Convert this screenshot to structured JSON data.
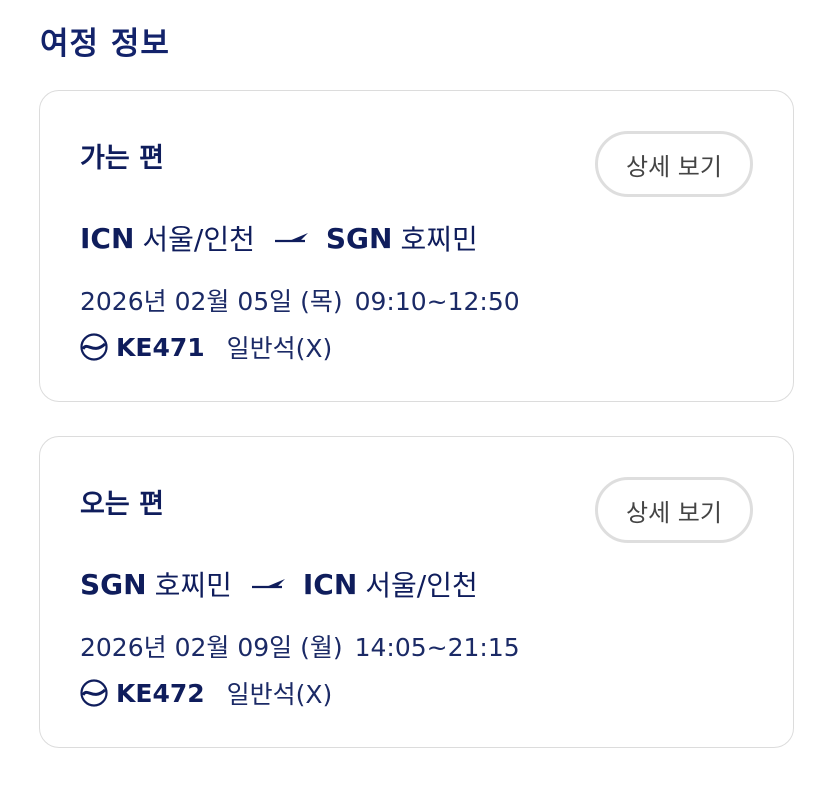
{
  "page": {
    "title": "여정 정보"
  },
  "colors": {
    "primary": "#0f1d5c",
    "border": "#dcdcdc",
    "button_border": "#dedede"
  },
  "icons": {
    "route_arrow": "plane-arrow-icon",
    "airline_logo": "korean-air-logo-icon"
  },
  "segments": [
    {
      "title": "가는 편",
      "detail_label": "상세 보기",
      "from_code": "ICN",
      "from_city": "서울/인천",
      "to_code": "SGN",
      "to_city": "호찌민",
      "date": "2026년 02월 05일 (목)",
      "time": "09:10~12:50",
      "flight_no": "KE471",
      "cabin": "일반석(X)"
    },
    {
      "title": "오는 편",
      "detail_label": "상세 보기",
      "from_code": "SGN",
      "from_city": "호찌민",
      "to_code": "ICN",
      "to_city": "서울/인천",
      "date": "2026년 02월 09일 (월)",
      "time": "14:05~21:15",
      "flight_no": "KE472",
      "cabin": "일반석(X)"
    }
  ]
}
